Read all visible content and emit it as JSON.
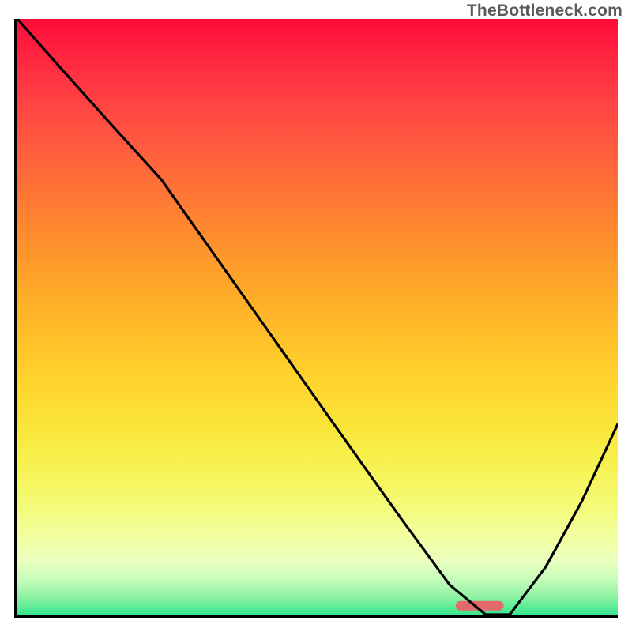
{
  "watermark": "TheBottleneck.com",
  "colors": {
    "marker": "#e36a6a",
    "curve": "#000000",
    "axis": "#000000"
  },
  "chart_data": {
    "type": "line",
    "title": "",
    "xlabel": "",
    "ylabel": "",
    "xlim": [
      0,
      100
    ],
    "ylim": [
      0,
      100
    ],
    "grid": false,
    "legend": false,
    "series": [
      {
        "name": "bottleneck-curve",
        "x": [
          0,
          7,
          15,
          24,
          38,
          52,
          64,
          72,
          78,
          82,
          88,
          94,
          100
        ],
        "values": [
          100,
          92,
          83,
          73,
          53,
          33,
          16,
          5,
          0,
          0,
          8,
          19,
          32
        ]
      }
    ],
    "marker": {
      "x_start": 73,
      "x_end": 81,
      "y": 1.5
    },
    "gradient_stops": [
      {
        "pos": 0,
        "color": "#ff0b3a"
      },
      {
        "pos": 50,
        "color": "#ffbe28"
      },
      {
        "pos": 82,
        "color": "#f4fb7a"
      },
      {
        "pos": 100,
        "color": "#37e58e"
      }
    ]
  }
}
